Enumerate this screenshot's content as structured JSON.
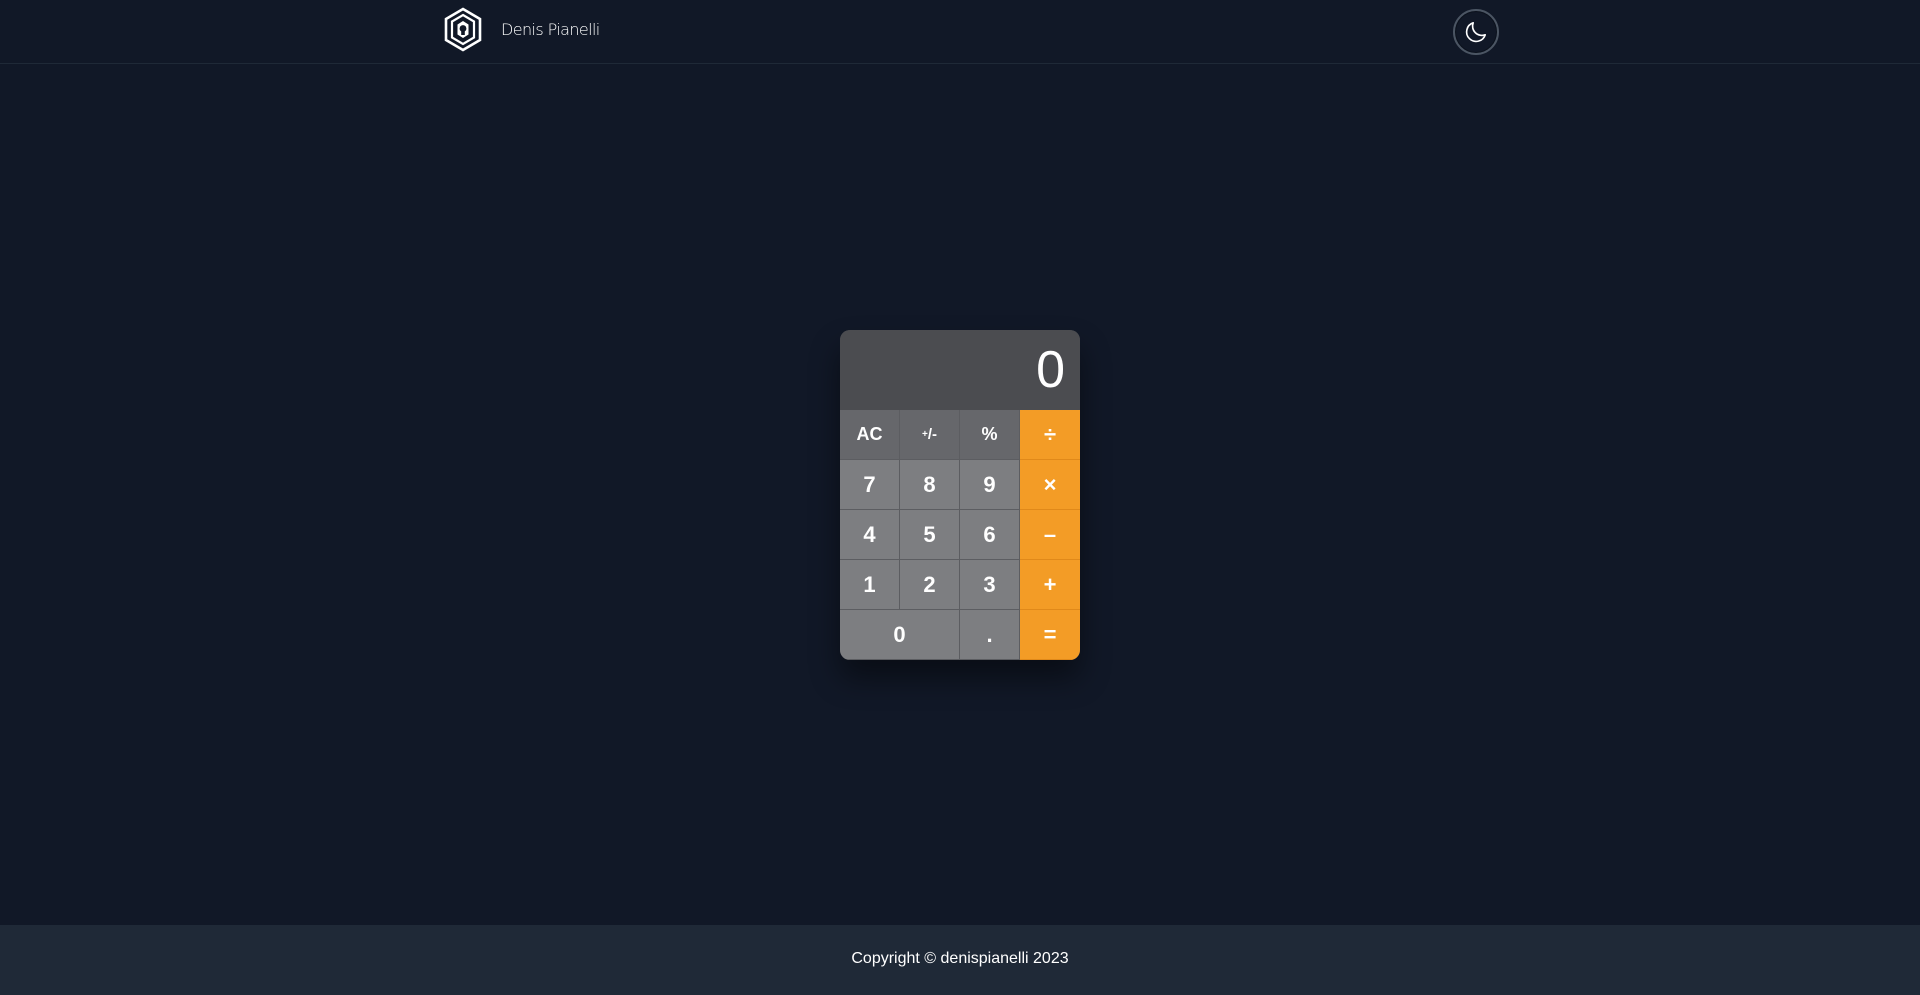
{
  "header": {
    "brand_name": "Denis Pianelli",
    "logo_icon": "hexagon-face-logo",
    "theme_toggle_icon": "moon-icon"
  },
  "calculator": {
    "display_value": "0",
    "keys": {
      "ac": "AC",
      "sign_sup": "+",
      "sign_rest": "/-",
      "percent": "%",
      "divide": "÷",
      "seven": "7",
      "eight": "8",
      "nine": "9",
      "multiply": "×",
      "four": "4",
      "five": "5",
      "six": "6",
      "minus": "–",
      "one": "1",
      "two": "2",
      "three": "3",
      "plus": "+",
      "zero": "0",
      "decimal": ".",
      "equals": "="
    },
    "colors": {
      "function_key": "#66676b",
      "number_key": "#7d7e81",
      "operator_key": "#f39c26",
      "display": "#4b4c50"
    }
  },
  "footer": {
    "copyright": "Copyright © denispianelli 2023"
  },
  "colors": {
    "background": "#111827",
    "footer_background": "#1f2937"
  }
}
